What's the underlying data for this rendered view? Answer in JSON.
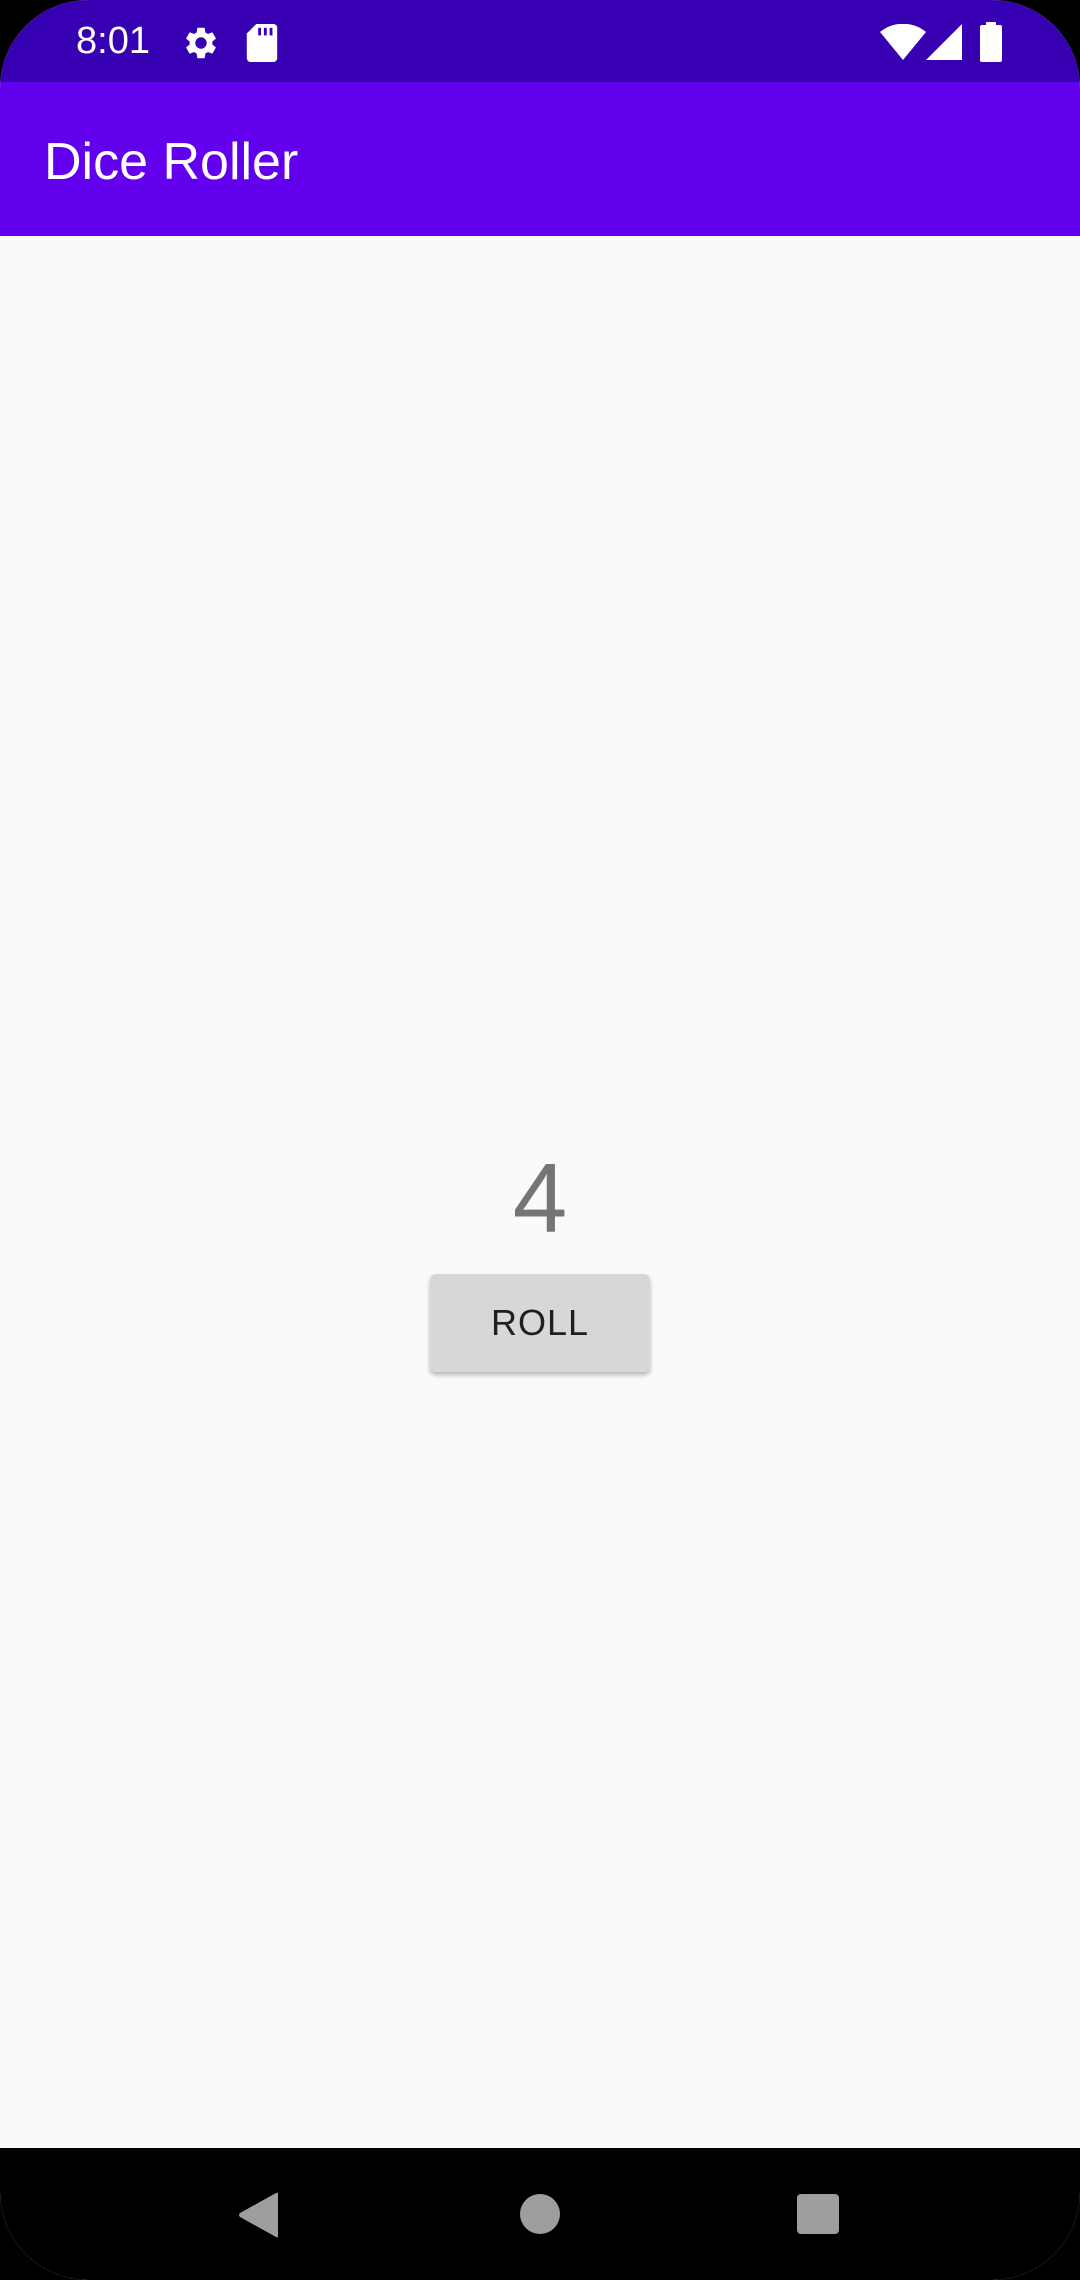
{
  "status_bar": {
    "time": "8:01",
    "left_icons": [
      "gear-icon",
      "sd-card-icon"
    ],
    "right_icons": [
      "wifi-icon",
      "cell-signal-icon",
      "battery-icon"
    ],
    "background": "#3700b3"
  },
  "app_bar": {
    "title": "Dice Roller",
    "background": "#6200ee"
  },
  "main": {
    "dice_value": "4",
    "roll_button_label": "ROLL",
    "background": "#fafafa"
  },
  "nav_bar": {
    "buttons": [
      "back-icon",
      "home-icon",
      "recents-icon"
    ]
  }
}
